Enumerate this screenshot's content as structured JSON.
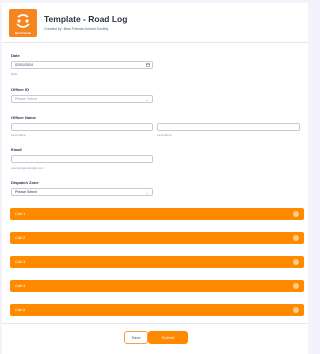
{
  "header": {
    "title": "Template - Road Log",
    "subtitle": "Created by: Best Friends Animal Society",
    "logo_text": "Best Friends"
  },
  "date": {
    "label": "Date",
    "value": "02/01/2024",
    "sublabel": "Date"
  },
  "officer_id": {
    "label": "Officer ID",
    "placeholder": "Please Select"
  },
  "officer_name": {
    "label": "Officer Name",
    "first_sublabel": "First Name",
    "last_sublabel": "Last Name"
  },
  "email": {
    "label": "Email",
    "sublabel": "example@example.com"
  },
  "dispatch_zone": {
    "label": "Dispatch Zone",
    "value": "Please Select"
  },
  "calls": [
    {
      "label": "Call 1"
    },
    {
      "label": "Call 2"
    },
    {
      "label": "Call 3"
    },
    {
      "label": "Call 4"
    },
    {
      "label": "Call 5"
    }
  ],
  "footer": {
    "save_label": "Save",
    "submit_label": "Submit"
  },
  "colors": {
    "accent": "#ff8a00",
    "logo_bg": "#f5861f"
  }
}
